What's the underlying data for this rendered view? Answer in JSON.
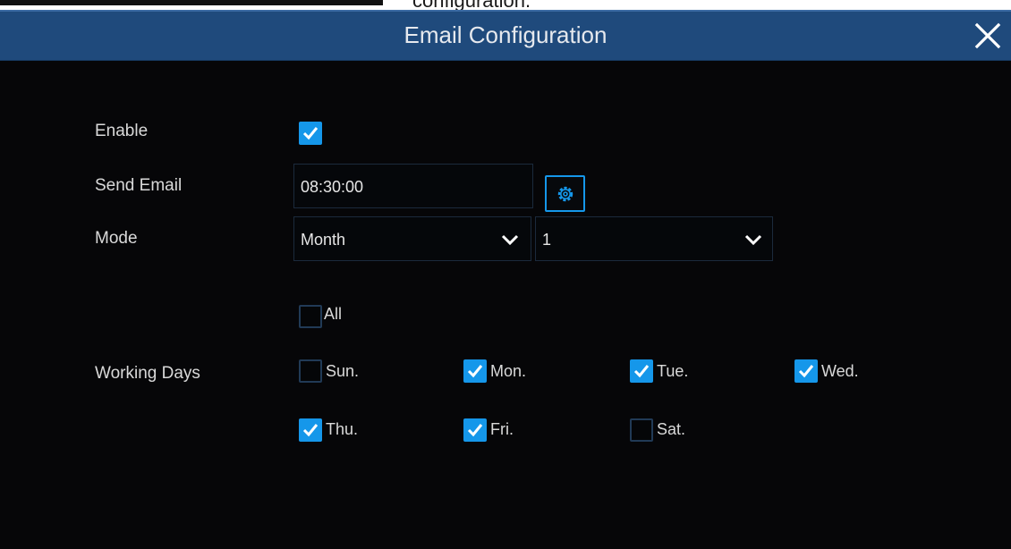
{
  "page_caption": "configuration.",
  "dialog": {
    "title": "Email Configuration"
  },
  "form": {
    "enable": {
      "label": "Enable",
      "checked": true
    },
    "send_email": {
      "label": "Send Email",
      "value": "08:30:00"
    },
    "mode": {
      "label": "Mode",
      "value": "Month",
      "day_value": "1"
    },
    "all": {
      "label": "All",
      "checked": false
    },
    "working_days": {
      "label": "Working Days",
      "days": [
        {
          "label": "Sun.",
          "checked": false
        },
        {
          "label": "Mon.",
          "checked": true
        },
        {
          "label": "Tue.",
          "checked": true
        },
        {
          "label": "Wed.",
          "checked": true
        },
        {
          "label": "Thu.",
          "checked": true
        },
        {
          "label": "Fri.",
          "checked": true
        },
        {
          "label": "Sat.",
          "checked": false
        }
      ]
    }
  },
  "colors": {
    "header_bg": "#1f4a7c",
    "accent": "#1597ea",
    "background": "#060608"
  },
  "icons": {
    "close": "close-icon",
    "settings": "gear-icon",
    "dropdown": "chevron-down-icon",
    "check": "check-icon"
  }
}
